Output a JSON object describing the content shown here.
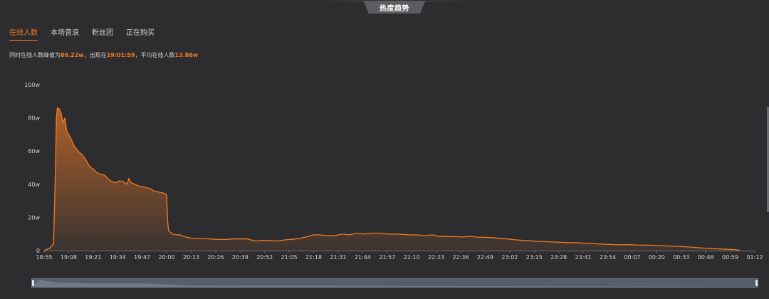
{
  "header": {
    "title": "热度趋势"
  },
  "tabs": [
    {
      "label": "在线人数",
      "active": true
    },
    {
      "label": "本场音浪",
      "active": false
    },
    {
      "label": "粉丝团",
      "active": false
    },
    {
      "label": "正在购买",
      "active": false
    }
  ],
  "summary": {
    "prefix": "同时在线人数峰值为",
    "peak": "86.22w",
    "mid": "，出现在",
    "peak_time": "19:01:59",
    "mid2": "，平均在线人数",
    "average": "13.86w"
  },
  "colors": {
    "accent": "#f07c22",
    "background": "#2d2d30",
    "fill_top": "#b86428",
    "fill_bottom": "#3d3430"
  },
  "chart_data": {
    "type": "area",
    "ylim": [
      0,
      100
    ],
    "y_ticks": [
      "0",
      "20w",
      "40w",
      "60w",
      "80w",
      "100w"
    ],
    "y_tick_values": [
      0,
      20,
      40,
      60,
      80,
      100
    ],
    "x_tick_labels": [
      "18:55",
      "19:08",
      "19:21",
      "19:34",
      "19:47",
      "20:00",
      "20:13",
      "20:26",
      "20:39",
      "20:52",
      "21:05",
      "21:18",
      "21:31",
      "21:44",
      "21:57",
      "22:10",
      "22:23",
      "22:36",
      "22:49",
      "23:02",
      "23:15",
      "23:28",
      "23:41",
      "23:54",
      "00:07",
      "00:20",
      "00:33",
      "00:46",
      "00:59",
      "01:12"
    ],
    "series": [
      {
        "unit": "w",
        "points": [
          [
            0,
            0
          ],
          [
            3,
            1.5
          ],
          [
            5,
            4
          ],
          [
            6,
            50
          ],
          [
            6.5,
            80
          ],
          [
            7,
            86
          ],
          [
            8,
            85.5
          ],
          [
            9,
            83
          ],
          [
            10,
            77
          ],
          [
            11,
            80
          ],
          [
            12,
            72
          ],
          [
            13,
            70
          ],
          [
            14,
            68
          ],
          [
            16,
            63
          ],
          [
            18,
            60
          ],
          [
            20,
            58
          ],
          [
            22,
            55
          ],
          [
            24,
            51
          ],
          [
            26,
            49
          ],
          [
            28,
            47
          ],
          [
            30,
            46
          ],
          [
            32,
            45.5
          ],
          [
            34,
            43
          ],
          [
            36,
            41.5
          ],
          [
            38,
            41
          ],
          [
            40,
            42
          ],
          [
            42,
            41.5
          ],
          [
            44,
            40
          ],
          [
            45,
            43.5
          ],
          [
            46,
            41
          ],
          [
            48,
            40
          ],
          [
            50,
            39
          ],
          [
            52,
            38.5
          ],
          [
            54,
            38
          ],
          [
            56,
            37.5
          ],
          [
            58,
            36
          ],
          [
            60,
            35.5
          ],
          [
            62,
            35
          ],
          [
            64,
            34.5
          ],
          [
            65,
            33.5
          ],
          [
            65.5,
            18
          ],
          [
            66,
            12
          ],
          [
            68,
            10
          ],
          [
            70,
            9.5
          ],
          [
            72,
            9.5
          ],
          [
            74,
            8.5
          ],
          [
            76,
            8
          ],
          [
            78,
            7.5
          ],
          [
            80,
            7.3
          ],
          [
            84,
            7.3
          ],
          [
            88,
            7
          ],
          [
            92,
            6.8
          ],
          [
            96,
            6.7
          ],
          [
            100,
            7
          ],
          [
            104,
            7.1
          ],
          [
            108,
            7
          ],
          [
            112,
            5.8
          ],
          [
            116,
            6.2
          ],
          [
            120,
            6
          ],
          [
            124,
            5.8
          ],
          [
            128,
            6.5
          ],
          [
            132,
            6.8
          ],
          [
            136,
            7.5
          ],
          [
            140,
            8.5
          ],
          [
            143,
            9.5
          ],
          [
            146,
            9.5
          ],
          [
            150,
            9
          ],
          [
            154,
            9
          ],
          [
            158,
            10
          ],
          [
            162,
            9.5
          ],
          [
            166,
            10.5
          ],
          [
            170,
            10
          ],
          [
            174,
            10.5
          ],
          [
            178,
            10.5
          ],
          [
            182,
            10
          ],
          [
            186,
            10
          ],
          [
            190,
            9.8
          ],
          [
            194,
            9.5
          ],
          [
            198,
            9.5
          ],
          [
            202,
            9
          ],
          [
            206,
            9.5
          ],
          [
            210,
            8.5
          ],
          [
            214,
            8.5
          ],
          [
            218,
            8.4
          ],
          [
            222,
            8.2
          ],
          [
            226,
            8.6
          ],
          [
            230,
            8.1
          ],
          [
            234,
            8
          ],
          [
            238,
            7.8
          ],
          [
            242,
            7.4
          ],
          [
            246,
            7
          ],
          [
            250,
            6.5
          ],
          [
            254,
            6.2
          ],
          [
            258,
            5.9
          ],
          [
            262,
            5.6
          ],
          [
            266,
            5.4
          ],
          [
            270,
            5.2
          ],
          [
            274,
            5
          ],
          [
            278,
            4.8
          ],
          [
            282,
            4.7
          ],
          [
            286,
            4.5
          ],
          [
            290,
            4.3
          ],
          [
            294,
            4
          ],
          [
            298,
            3.8
          ],
          [
            302,
            3.6
          ],
          [
            306,
            3.5
          ],
          [
            310,
            3.6
          ],
          [
            314,
            3.4
          ],
          [
            318,
            3.3
          ],
          [
            322,
            3.2
          ],
          [
            326,
            3
          ],
          [
            330,
            2.8
          ],
          [
            334,
            2.6
          ],
          [
            338,
            2.4
          ],
          [
            342,
            2.2
          ],
          [
            346,
            1.8
          ],
          [
            350,
            1.5
          ],
          [
            354,
            1.2
          ],
          [
            358,
            1
          ],
          [
            362,
            0.8
          ],
          [
            366,
            0.6
          ],
          [
            369,
            0.2
          ]
        ]
      }
    ]
  }
}
